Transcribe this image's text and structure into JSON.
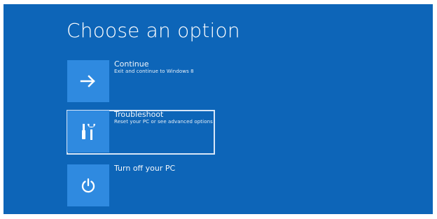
{
  "window": {
    "background_color": "#0d65b8",
    "tile_color": "#2f8ae0",
    "selected_border_color": "#d7e6f8"
  },
  "header": {
    "title": "Choose an option"
  },
  "options": [
    {
      "title": "Continue",
      "subtitle": "Exit and continue to Windows 8",
      "icon": "arrow-right-icon",
      "selected": false
    },
    {
      "title": "Troubleshoot",
      "subtitle": "Reset your PC or see advanced options",
      "icon": "tools-icon",
      "selected": true
    },
    {
      "title": "Turn off your PC",
      "subtitle": "",
      "icon": "power-icon",
      "selected": false
    }
  ]
}
